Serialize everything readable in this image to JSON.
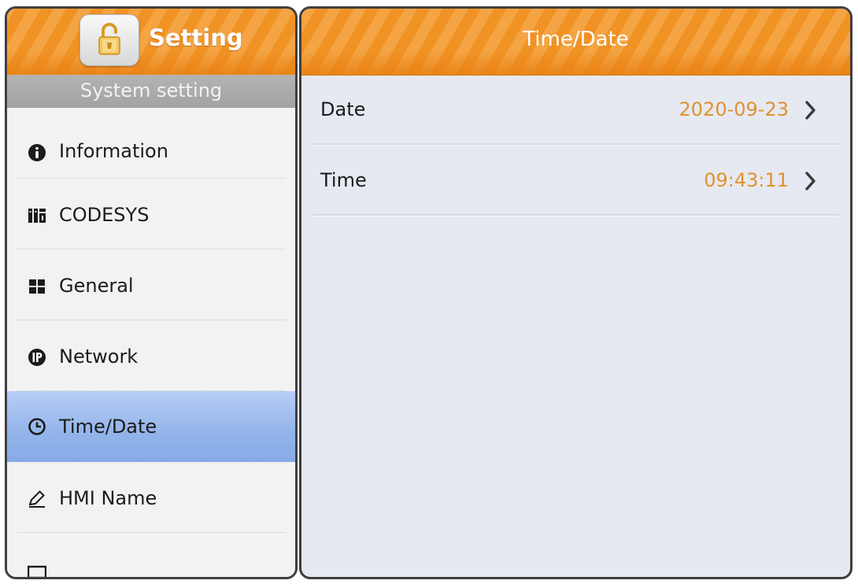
{
  "sidebar": {
    "title": "Setting",
    "section_label": "System setting",
    "lock_icon": "unlocked-padlock-icon",
    "items": [
      {
        "label": "Information",
        "icon": "info-icon"
      },
      {
        "label": "CODESYS",
        "icon": "codesys-icon"
      },
      {
        "label": "General",
        "icon": "grid-icon"
      },
      {
        "label": "Network",
        "icon": "ip-icon"
      },
      {
        "label": "Time/Date",
        "icon": "clock-icon",
        "selected": true
      },
      {
        "label": "HMI Name",
        "icon": "pen-icon"
      }
    ]
  },
  "main": {
    "title": "Time/Date",
    "rows": [
      {
        "label": "Date",
        "value": "2020-09-23"
      },
      {
        "label": "Time",
        "value": "09:43:11"
      }
    ]
  },
  "colors": {
    "header_orange": "#f19225",
    "value_orange": "#e0922e",
    "selected_blue": "#93b4ea",
    "section_gray": "#a8a8a8",
    "content_bg": "#e6e9f1"
  }
}
